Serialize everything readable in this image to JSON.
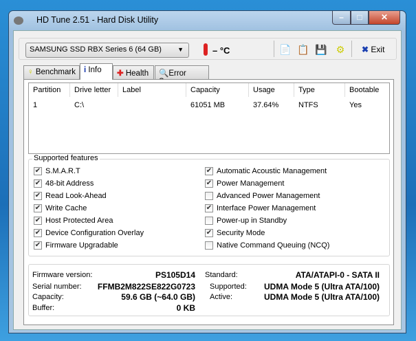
{
  "window": {
    "title": "HD Tune 2.51 - Hard Disk Utility"
  },
  "toolbar": {
    "drive": "SAMSUNG SSD RBX Series 6 (64 GB)",
    "temperature": "– °C",
    "exit_label": "Exit"
  },
  "tabs": [
    {
      "label": "Benchmark"
    },
    {
      "label": "Info"
    },
    {
      "label": "Health"
    },
    {
      "label": "Error Scan"
    }
  ],
  "partitions": {
    "headers": [
      "Partition",
      "Drive letter",
      "Label",
      "Capacity",
      "Usage",
      "Type",
      "Bootable"
    ],
    "rows": [
      [
        "1",
        "C:\\",
        "",
        "61051 MB",
        "37.64%",
        "NTFS",
        "Yes"
      ]
    ]
  },
  "features": {
    "title": "Supported features",
    "left": [
      {
        "label": "S.M.A.R.T",
        "checked": true
      },
      {
        "label": "48-bit Address",
        "checked": true
      },
      {
        "label": "Read Look-Ahead",
        "checked": true
      },
      {
        "label": "Write Cache",
        "checked": true
      },
      {
        "label": "Host Protected Area",
        "checked": true
      },
      {
        "label": "Device Configuration Overlay",
        "checked": true
      },
      {
        "label": "Firmware Upgradable",
        "checked": true
      }
    ],
    "right": [
      {
        "label": "Automatic Acoustic Management",
        "checked": true
      },
      {
        "label": "Power Management",
        "checked": true
      },
      {
        "label": "Advanced Power Management",
        "checked": false
      },
      {
        "label": "Interface Power Management",
        "checked": true
      },
      {
        "label": "Power-up in Standby",
        "checked": false
      },
      {
        "label": "Security Mode",
        "checked": true
      },
      {
        "label": "Native Command Queuing (NCQ)",
        "checked": false
      }
    ]
  },
  "info": {
    "firmware_label": "Firmware version:",
    "firmware": "PS105D14",
    "serial_label": "Serial number:",
    "serial": "FFMB2M822SE822G0723",
    "capacity_label": "Capacity:",
    "capacity": "59.6 GB (~64.0 GB)",
    "buffer_label": "Buffer:",
    "buffer": "0 KB",
    "standard_label": "Standard:",
    "standard": "ATA/ATAPI-0 - SATA II",
    "supported_label": "Supported:",
    "supported": "UDMA Mode 5 (Ultra ATA/100)",
    "active_label": "Active:",
    "active": "UDMA Mode 5 (Ultra ATA/100)"
  }
}
